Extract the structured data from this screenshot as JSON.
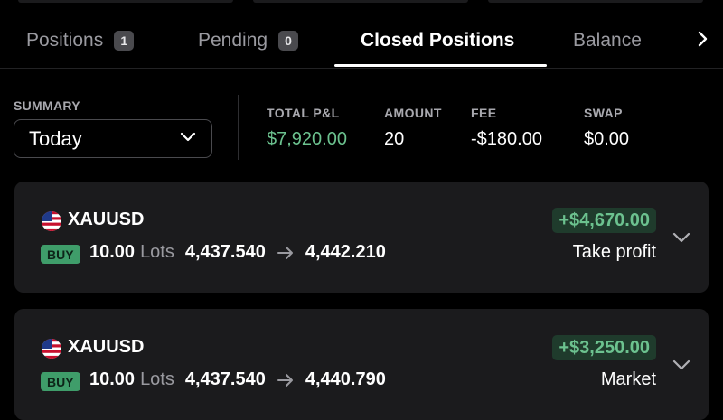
{
  "tabs": [
    {
      "label": "Positions",
      "badge": "1"
    },
    {
      "label": "Pending",
      "badge": "0"
    },
    {
      "label": "Closed Positions",
      "badge": ""
    },
    {
      "label": "Balance",
      "badge": ""
    }
  ],
  "active_tab": "Closed Positions",
  "summary": {
    "label": "SUMMARY",
    "period_value": "Today",
    "stats": [
      {
        "label": "TOTAL P&L",
        "value": "$7,920.00",
        "color": "#6cc28f"
      },
      {
        "label": "AMOUNT",
        "value": "20",
        "color": "#ffffff"
      },
      {
        "label": "FEE",
        "value": "-$180.00",
        "color": "#ffffff"
      },
      {
        "label": "SWAP",
        "value": "$0.00",
        "color": "#ffffff"
      }
    ]
  },
  "positions": [
    {
      "flag_icon": "us-flag-icon",
      "symbol": "XAUUSD",
      "side": "BUY",
      "lots": "10.00",
      "lots_unit": "Lots",
      "open_price": "4,437.540",
      "close_price": "4,442.210",
      "pnl": "+$4,670.00",
      "close_reason": "Take profit"
    },
    {
      "flag_icon": "us-flag-icon",
      "symbol": "XAUUSD",
      "side": "BUY",
      "lots": "10.00",
      "lots_unit": "Lots",
      "open_price": "4,437.540",
      "close_price": "4,440.790",
      "pnl": "+$3,250.00",
      "close_reason": "Market"
    }
  ],
  "colors": {
    "background": "#000000",
    "card": "#1b1b1d",
    "profit": "#6cc28f",
    "buy_badge": "#3f9d6a"
  },
  "icons": {
    "tab_next": "chevron-right-icon",
    "select": "chevron-down-icon",
    "arrow": "arrow-right-icon",
    "expand": "chevron-down-icon"
  }
}
